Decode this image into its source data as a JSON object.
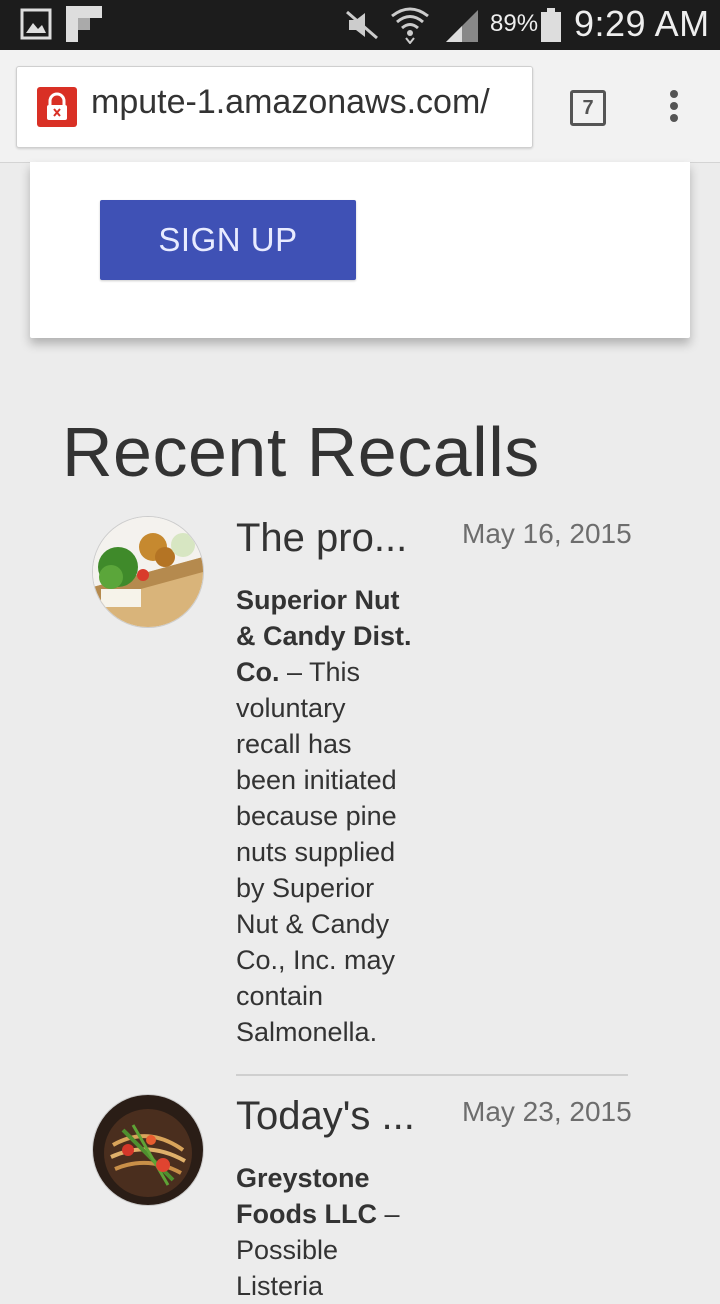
{
  "status_bar": {
    "battery_percent": "89%",
    "time": "9:29 AM",
    "icons": [
      "gallery-icon",
      "flipboard-icon",
      "mute-icon",
      "wifi-icon",
      "signal-icon",
      "battery-icon"
    ]
  },
  "browser": {
    "url": "mpute-1.amazonaws.com/",
    "tab_count": "7",
    "security_icon": "insecure-lock-icon",
    "menu_icon": "overflow-menu-icon"
  },
  "signup": {
    "button_label": "SIGN UP"
  },
  "recalls_section": {
    "title": "Recent Recalls",
    "items": [
      {
        "title": "The pro...",
        "date": "May 16, 2015",
        "company": "Superior Nut & Candy Dist. Co.",
        "separator": " – ",
        "description": "This voluntary recall has been initiated because pine nuts supplied by Superior Nut & Candy Co., Inc. may contain Salmonella."
      },
      {
        "title": "Today's ...",
        "date": "May 23, 2015",
        "company": "Greystone Foods LLC",
        "separator": " – ",
        "description": "Possible Listeria"
      }
    ]
  },
  "colors": {
    "accent_button": "#3f51b5",
    "page_background": "#ececec",
    "status_bar": "#1c1c1c",
    "insecure_lock": "#d93025"
  }
}
